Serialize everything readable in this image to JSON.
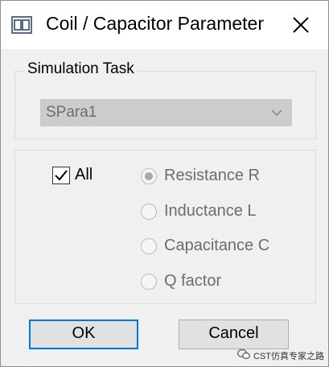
{
  "window": {
    "title": "Coil / Capacitor Parameter",
    "app_icon": "coil-app-icon",
    "close_icon": "close-icon"
  },
  "simulation_task": {
    "legend": "Simulation Task",
    "selected": "SPara1",
    "enabled": false
  },
  "options": {
    "all_label": "All",
    "all_checked": true,
    "radios": [
      {
        "label": "Resistance R",
        "selected": true
      },
      {
        "label": "Inductance L",
        "selected": false
      },
      {
        "label": "Capacitance C",
        "selected": false
      },
      {
        "label": "Q factor",
        "selected": false
      }
    ]
  },
  "buttons": {
    "ok": "OK",
    "cancel": "Cancel"
  },
  "watermark": {
    "text": "CST仿真专家之路"
  },
  "colors": {
    "focus_accent": "#0078d7",
    "dialog_bg": "#f0f0f0",
    "disabled_text": "#6d6d6d"
  }
}
